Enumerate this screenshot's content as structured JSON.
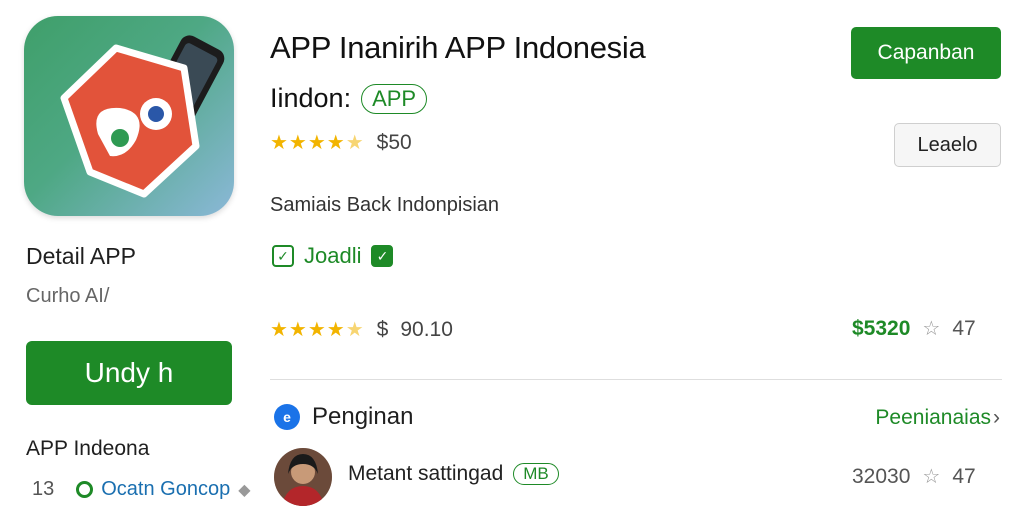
{
  "header": {
    "title": "APP Inanirih APP Indonesia",
    "subtitle": "Iindon:",
    "subtitle_badge": "APP",
    "rating_stars": 4.5,
    "rating_price": "$50",
    "primary_button": "Capanban",
    "secondary_button": "Leaelo"
  },
  "sidebar": {
    "detail_title": "Detail APP",
    "detail_subtitle": "Curho AI/",
    "install_button": "Undy h",
    "footer_title": "APP Indeona",
    "footer_count": "13",
    "footer_link": "Ocatn Goncop",
    "footer_icon": "diamond-icon"
  },
  "main": {
    "description": "Samiais Back Indonpisian",
    "check_label": "Joadli",
    "rating2_stars": 4.5,
    "rating2_currency": "$",
    "rating2_value": "90.10",
    "price_right": "$5320",
    "price_right_count": "47"
  },
  "section": {
    "title": "Penginan",
    "link": "Peenianaias",
    "link_chevron": "›"
  },
  "review": {
    "name": "Metant sattingad",
    "badge": "MB",
    "value": "32030",
    "count": "47"
  },
  "colors": {
    "accent_green": "#1e8a27",
    "star_gold": "#f2b400",
    "link_blue": "#1a6fb0"
  }
}
